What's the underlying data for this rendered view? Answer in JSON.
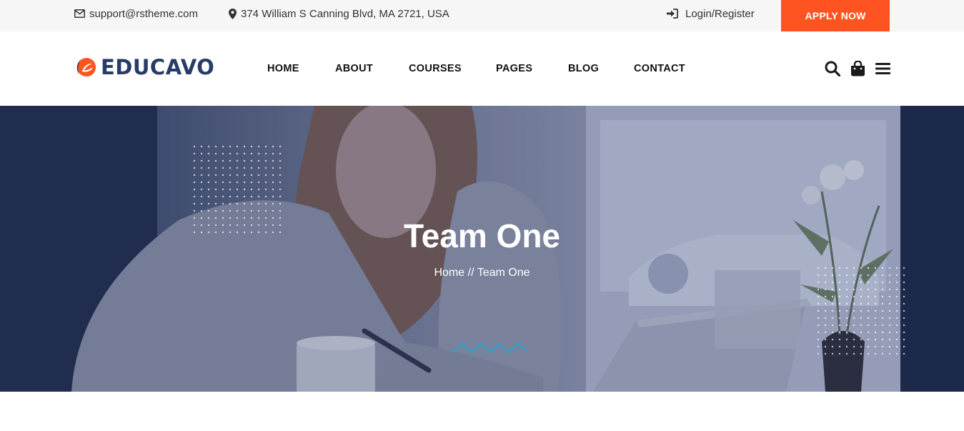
{
  "topbar": {
    "email": "support@rstheme.com",
    "address": "374 William S Canning Blvd, MA 2721, USA",
    "login": "Login/Register",
    "apply": "APPLY NOW"
  },
  "header": {
    "logo_text": "EDUCAVO",
    "nav": [
      "HOME",
      "ABOUT",
      "COURSES",
      "PAGES",
      "BLOG",
      "CONTACT"
    ],
    "icons": [
      "search-icon",
      "shopping-bag-icon",
      "menu-icon"
    ]
  },
  "hero": {
    "title": "Team One",
    "breadcrumb_home": "Home",
    "breadcrumb_sep": "//",
    "breadcrumb_current": "Team One"
  },
  "colors": {
    "accent": "#ff5421",
    "brand": "#273c66",
    "topbar_bg": "#f6f6f6",
    "wave": "#21a7d0"
  }
}
